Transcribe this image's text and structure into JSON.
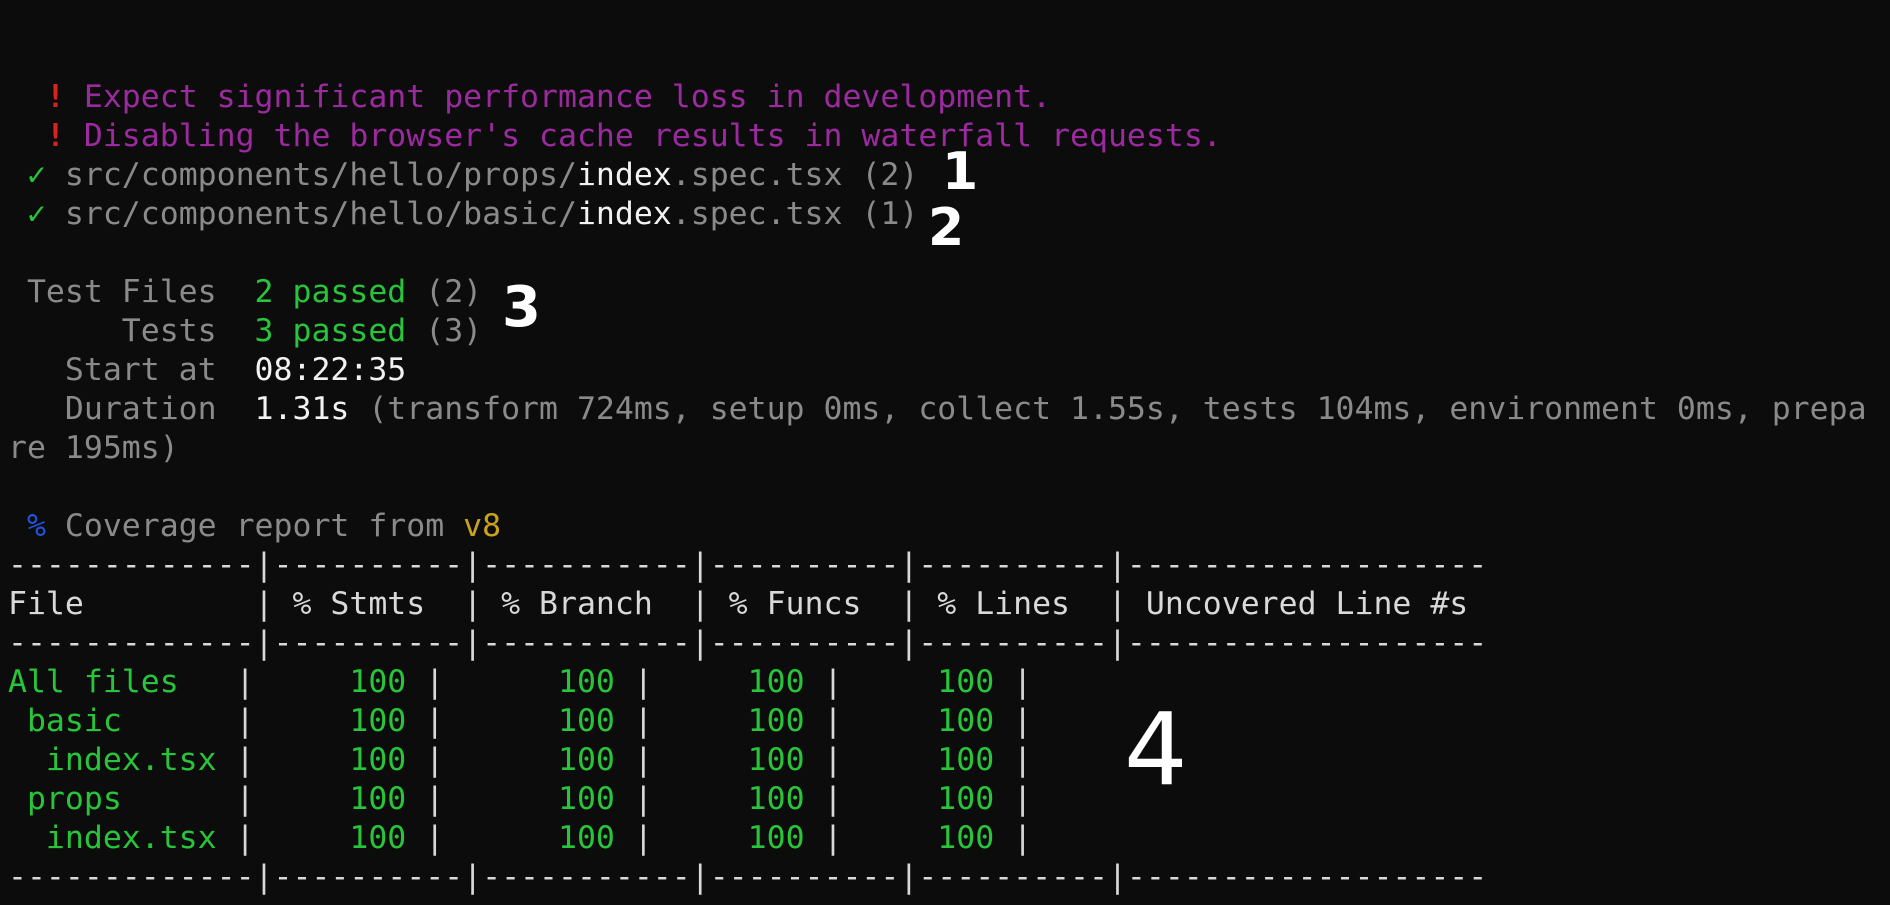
{
  "warnings": [
    {
      "icon": "!",
      "text": "Expect significant performance loss in development."
    },
    {
      "icon": "!",
      "text": "Disabling the browser's cache results in waterfall requests."
    }
  ],
  "spec_files": [
    {
      "check": "✓",
      "dir": "src/components/hello/props/",
      "name": "index",
      "ext": ".spec.tsx",
      "count": "(2)"
    },
    {
      "check": "✓",
      "dir": "src/components/hello/basic/",
      "name": "index",
      "ext": ".spec.tsx",
      "count": "(1)"
    }
  ],
  "summary": {
    "test_files_label": " Test Files  ",
    "test_files_value": "2 passed",
    "test_files_count": " (2)",
    "tests_label": "      Tests  ",
    "tests_value": "3 passed",
    "tests_count": " (3)",
    "start_label": "   Start at  ",
    "start_value": "08:22:35",
    "duration_label": "   Duration  ",
    "duration_value": "1.31s",
    "duration_detail": " (transform 724ms, setup 0ms, collect 1.55s, tests 104ms, environment 0ms, prepa",
    "duration_wrap": "re 195ms)"
  },
  "coverage": {
    "icon": "%",
    "label": " Coverage report from ",
    "provider": "v8",
    "separator": "-------------|----------|-----------|----------|----------|-------------------",
    "header": "File         | % Stmts  | % Branch  | % Funcs  | % Lines  | Uncovered Line #s ",
    "columns": [
      "File",
      "% Stmts",
      "% Branch",
      "% Funcs",
      "% Lines",
      "Uncovered Line #s"
    ],
    "rows": [
      {
        "name": "All files   ",
        "stmts": "     100 ",
        "branch": "      100 ",
        "funcs": "     100 ",
        "lines": "     100 "
      },
      {
        "name": " basic      ",
        "stmts": "     100 ",
        "branch": "      100 ",
        "funcs": "     100 ",
        "lines": "     100 "
      },
      {
        "name": "  index.tsx ",
        "stmts": "     100 ",
        "branch": "      100 ",
        "funcs": "     100 ",
        "lines": "     100 "
      },
      {
        "name": " props      ",
        "stmts": "     100 ",
        "branch": "      100 ",
        "funcs": "     100 ",
        "lines": "     100 "
      },
      {
        "name": "  index.tsx ",
        "stmts": "     100 ",
        "branch": "      100 ",
        "funcs": "     100 ",
        "lines": "     100 "
      }
    ]
  },
  "annotations": [
    "1",
    "2",
    "3",
    "4"
  ]
}
